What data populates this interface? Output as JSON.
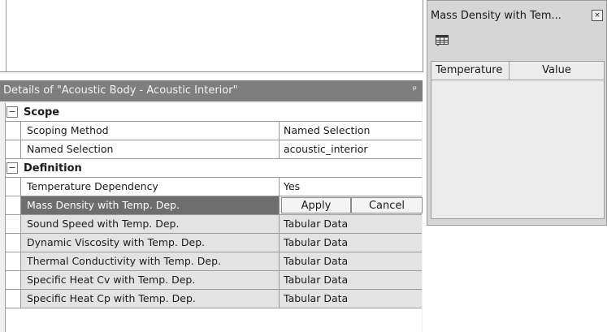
{
  "details": {
    "title": "Details of \"Acoustic Body - Acoustic Interior\"",
    "pin": "ᵖ",
    "sections": [
      {
        "toggle": "−",
        "label": "Scope",
        "rows": [
          {
            "name": "Scoping Method",
            "value": "Named Selection"
          },
          {
            "name": "Named Selection",
            "value": "acoustic_interior"
          }
        ]
      },
      {
        "toggle": "−",
        "label": "Definition",
        "rows": [
          {
            "name": "Temperature Dependency",
            "value": "Yes"
          },
          {
            "name": "Mass Density with Temp. Dep.",
            "apply": "Apply",
            "cancel": "Cancel"
          },
          {
            "name": "Sound Speed with Temp. Dep.",
            "value": "Tabular Data"
          },
          {
            "name": "Dynamic Viscosity with Temp. Dep.",
            "value": "Tabular Data"
          },
          {
            "name": "Thermal Conductivity with Temp. Dep.",
            "value": "Tabular Data"
          },
          {
            "name": "Specific Heat Cv with Temp. Dep.",
            "value": "Tabular Data"
          },
          {
            "name": "Specific Heat Cp with Temp. Dep.",
            "value": "Tabular Data"
          }
        ]
      }
    ]
  },
  "tabular_window": {
    "title": "Mass Density with Tem...",
    "close": "×",
    "columns": [
      "Temperature",
      "Value"
    ]
  }
}
